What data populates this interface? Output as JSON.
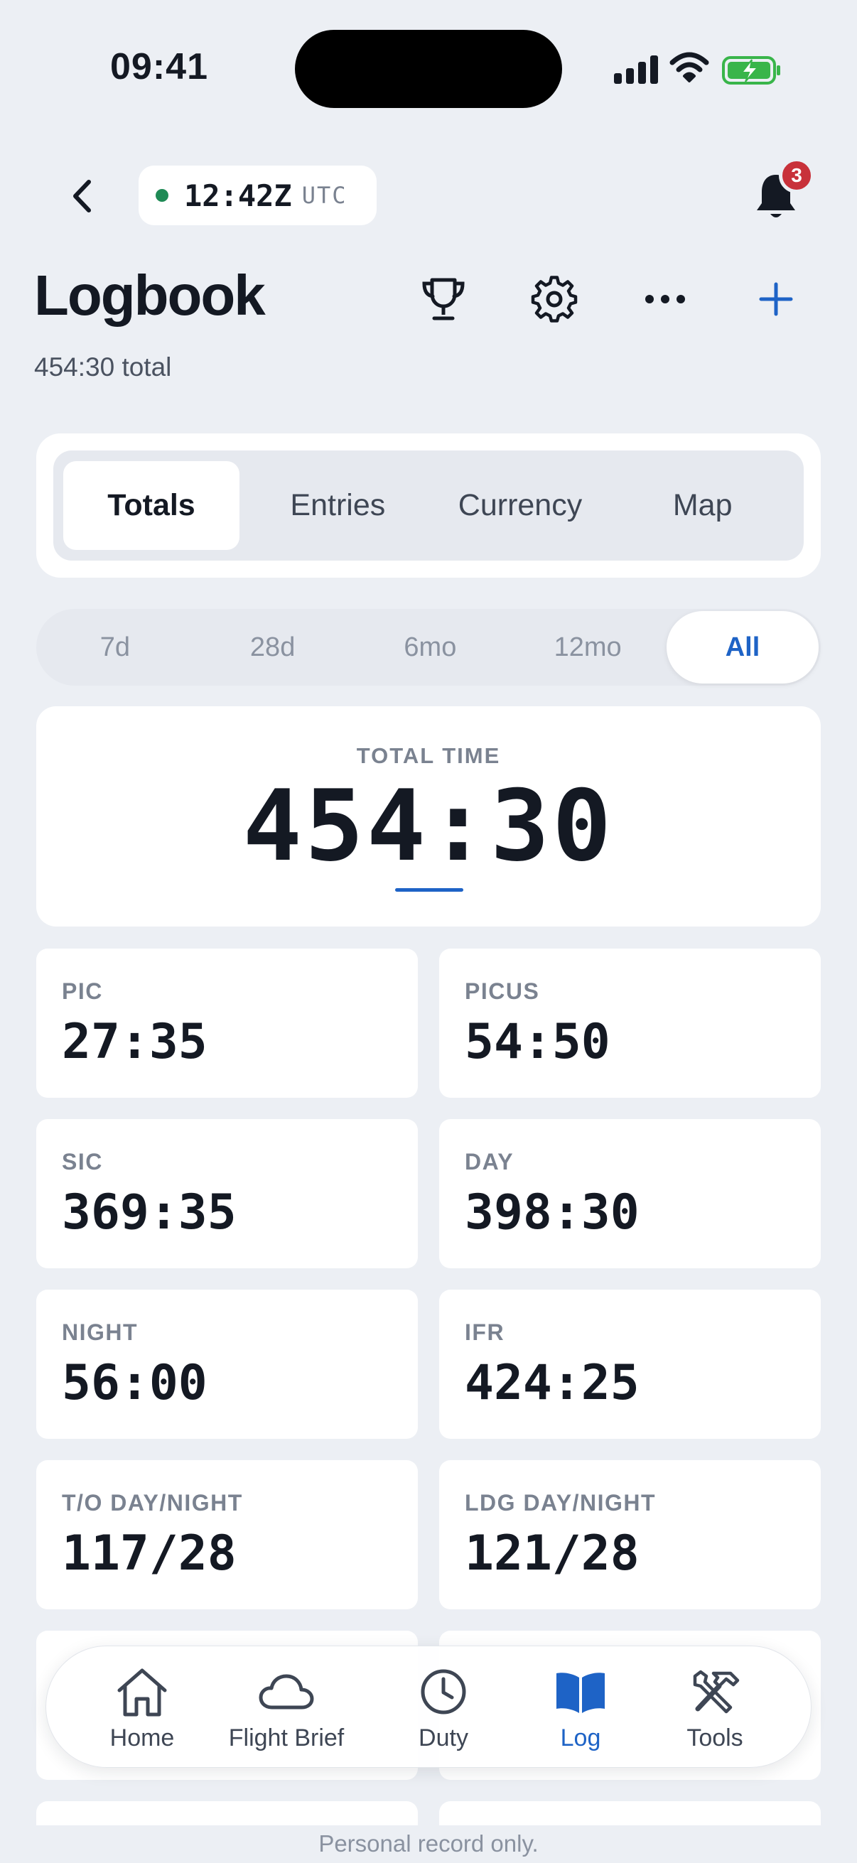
{
  "status_bar": {
    "time": "09:41"
  },
  "header": {
    "utc_time": "12:42Z",
    "utc_label": "UTC",
    "notification_count": "3"
  },
  "page": {
    "title": "Logbook",
    "subtitle": "454:30 total"
  },
  "tabs": [
    {
      "label": "Totals",
      "active": true
    },
    {
      "label": "Entries",
      "active": false
    },
    {
      "label": "Currency",
      "active": false
    },
    {
      "label": "Map",
      "active": false
    }
  ],
  "ranges": [
    {
      "label": "7d"
    },
    {
      "label": "28d"
    },
    {
      "label": "6mo"
    },
    {
      "label": "12mo"
    },
    {
      "label": "All",
      "active": true
    }
  ],
  "total": {
    "label": "TOTAL TIME",
    "value": "454:30"
  },
  "stats": [
    {
      "label": "PIC",
      "value": "27:35"
    },
    {
      "label": "PICUS",
      "value": "54:50"
    },
    {
      "label": "SIC",
      "value": "369:35"
    },
    {
      "label": "DAY",
      "value": "398:30"
    },
    {
      "label": "NIGHT",
      "value": "56:00"
    },
    {
      "label": "IFR",
      "value": "424:25"
    },
    {
      "label": "T/O DAY/NIGHT",
      "value": "117/28"
    },
    {
      "label": "LDG DAY/NIGHT",
      "value": "121/28"
    }
  ],
  "tabbar": [
    {
      "label": "Home",
      "icon": "home-icon"
    },
    {
      "label": "Flight Brief",
      "icon": "cloud-icon"
    },
    {
      "label": "Duty",
      "icon": "clock-icon"
    },
    {
      "label": "Log",
      "icon": "book-icon",
      "active": true
    },
    {
      "label": "Tools",
      "icon": "tools-icon"
    }
  ],
  "footer": {
    "note": "Personal record only."
  },
  "colors": {
    "accent": "#1e63c6",
    "live": "#1f8a55",
    "badge": "#c8313a",
    "background": "#eceff4"
  }
}
